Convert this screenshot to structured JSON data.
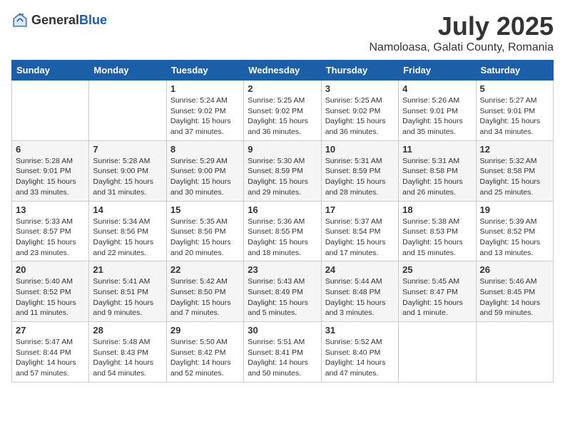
{
  "header": {
    "logo_general": "General",
    "logo_blue": "Blue",
    "month_title": "July 2025",
    "location": "Namoloasa, Galati County, Romania"
  },
  "days_of_week": [
    "Sunday",
    "Monday",
    "Tuesday",
    "Wednesday",
    "Thursday",
    "Friday",
    "Saturday"
  ],
  "weeks": [
    [
      {
        "day": "",
        "detail": ""
      },
      {
        "day": "",
        "detail": ""
      },
      {
        "day": "1",
        "detail": "Sunrise: 5:24 AM\nSunset: 9:02 PM\nDaylight: 15 hours and 37 minutes."
      },
      {
        "day": "2",
        "detail": "Sunrise: 5:25 AM\nSunset: 9:02 PM\nDaylight: 15 hours and 36 minutes."
      },
      {
        "day": "3",
        "detail": "Sunrise: 5:25 AM\nSunset: 9:02 PM\nDaylight: 15 hours and 36 minutes."
      },
      {
        "day": "4",
        "detail": "Sunrise: 5:26 AM\nSunset: 9:01 PM\nDaylight: 15 hours and 35 minutes."
      },
      {
        "day": "5",
        "detail": "Sunrise: 5:27 AM\nSunset: 9:01 PM\nDaylight: 15 hours and 34 minutes."
      }
    ],
    [
      {
        "day": "6",
        "detail": "Sunrise: 5:28 AM\nSunset: 9:01 PM\nDaylight: 15 hours and 33 minutes."
      },
      {
        "day": "7",
        "detail": "Sunrise: 5:28 AM\nSunset: 9:00 PM\nDaylight: 15 hours and 31 minutes."
      },
      {
        "day": "8",
        "detail": "Sunrise: 5:29 AM\nSunset: 9:00 PM\nDaylight: 15 hours and 30 minutes."
      },
      {
        "day": "9",
        "detail": "Sunrise: 5:30 AM\nSunset: 8:59 PM\nDaylight: 15 hours and 29 minutes."
      },
      {
        "day": "10",
        "detail": "Sunrise: 5:31 AM\nSunset: 8:59 PM\nDaylight: 15 hours and 28 minutes."
      },
      {
        "day": "11",
        "detail": "Sunrise: 5:31 AM\nSunset: 8:58 PM\nDaylight: 15 hours and 26 minutes."
      },
      {
        "day": "12",
        "detail": "Sunrise: 5:32 AM\nSunset: 8:58 PM\nDaylight: 15 hours and 25 minutes."
      }
    ],
    [
      {
        "day": "13",
        "detail": "Sunrise: 5:33 AM\nSunset: 8:57 PM\nDaylight: 15 hours and 23 minutes."
      },
      {
        "day": "14",
        "detail": "Sunrise: 5:34 AM\nSunset: 8:56 PM\nDaylight: 15 hours and 22 minutes."
      },
      {
        "day": "15",
        "detail": "Sunrise: 5:35 AM\nSunset: 8:56 PM\nDaylight: 15 hours and 20 minutes."
      },
      {
        "day": "16",
        "detail": "Sunrise: 5:36 AM\nSunset: 8:55 PM\nDaylight: 15 hours and 18 minutes."
      },
      {
        "day": "17",
        "detail": "Sunrise: 5:37 AM\nSunset: 8:54 PM\nDaylight: 15 hours and 17 minutes."
      },
      {
        "day": "18",
        "detail": "Sunrise: 5:38 AM\nSunset: 8:53 PM\nDaylight: 15 hours and 15 minutes."
      },
      {
        "day": "19",
        "detail": "Sunrise: 5:39 AM\nSunset: 8:52 PM\nDaylight: 15 hours and 13 minutes."
      }
    ],
    [
      {
        "day": "20",
        "detail": "Sunrise: 5:40 AM\nSunset: 8:52 PM\nDaylight: 15 hours and 11 minutes."
      },
      {
        "day": "21",
        "detail": "Sunrise: 5:41 AM\nSunset: 8:51 PM\nDaylight: 15 hours and 9 minutes."
      },
      {
        "day": "22",
        "detail": "Sunrise: 5:42 AM\nSunset: 8:50 PM\nDaylight: 15 hours and 7 minutes."
      },
      {
        "day": "23",
        "detail": "Sunrise: 5:43 AM\nSunset: 8:49 PM\nDaylight: 15 hours and 5 minutes."
      },
      {
        "day": "24",
        "detail": "Sunrise: 5:44 AM\nSunset: 8:48 PM\nDaylight: 15 hours and 3 minutes."
      },
      {
        "day": "25",
        "detail": "Sunrise: 5:45 AM\nSunset: 8:47 PM\nDaylight: 15 hours and 1 minute."
      },
      {
        "day": "26",
        "detail": "Sunrise: 5:46 AM\nSunset: 8:45 PM\nDaylight: 14 hours and 59 minutes."
      }
    ],
    [
      {
        "day": "27",
        "detail": "Sunrise: 5:47 AM\nSunset: 8:44 PM\nDaylight: 14 hours and 57 minutes."
      },
      {
        "day": "28",
        "detail": "Sunrise: 5:48 AM\nSunset: 8:43 PM\nDaylight: 14 hours and 54 minutes."
      },
      {
        "day": "29",
        "detail": "Sunrise: 5:50 AM\nSunset: 8:42 PM\nDaylight: 14 hours and 52 minutes."
      },
      {
        "day": "30",
        "detail": "Sunrise: 5:51 AM\nSunset: 8:41 PM\nDaylight: 14 hours and 50 minutes."
      },
      {
        "day": "31",
        "detail": "Sunrise: 5:52 AM\nSunset: 8:40 PM\nDaylight: 14 hours and 47 minutes."
      },
      {
        "day": "",
        "detail": ""
      },
      {
        "day": "",
        "detail": ""
      }
    ]
  ]
}
